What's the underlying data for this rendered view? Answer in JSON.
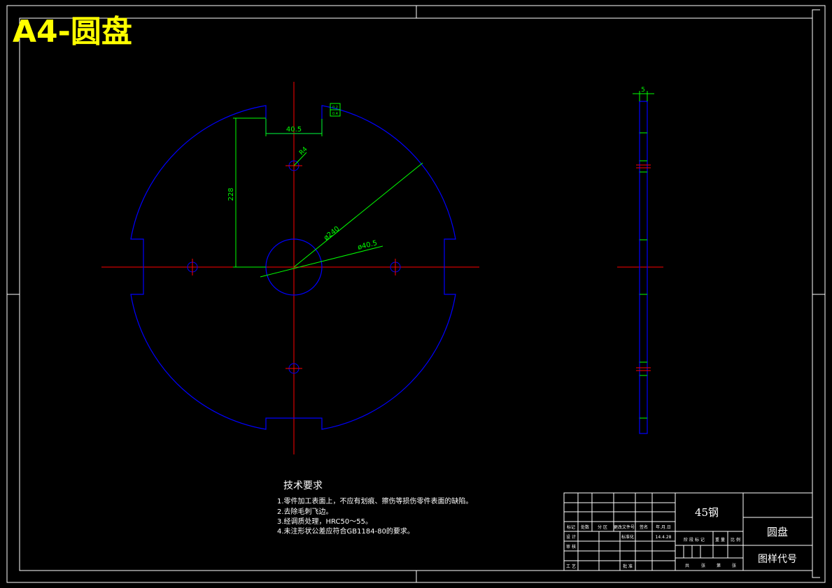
{
  "sheet": {
    "title": "A4-圆盘"
  },
  "dimensions": {
    "slot_width": "40.5",
    "height_from_center": "228",
    "small_hole_dia": "R4",
    "outer_dia": "ø240",
    "bore_dia": "ø40.5",
    "side_thickness": "5",
    "slot_tol_upper": "0.2",
    "slot_tol_lower": "0.4"
  },
  "tech_requirements": {
    "heading": "技术要求",
    "items": [
      "1.零件加工表面上，不应有划痕、擦伤等损伤零件表面的缺陷。",
      "2.去除毛刺飞边。",
      "3.经调质处理，HRC50～55。",
      "4.未注形状公差应符合GB1184-80的要求。"
    ]
  },
  "title_block": {
    "material": "45钢",
    "part_name": "圆盘",
    "drawing_code": "图样代号",
    "row_labels": [
      "标记",
      "处数",
      "分 区",
      "更改文件号",
      "签名",
      "年.月.日"
    ],
    "design": "设 计",
    "standardize": "标准化",
    "date": "14.4.28",
    "check": "审 核",
    "process": "工 艺",
    "approve": "批 准",
    "stage_labels": [
      "阶 段 标 记",
      "重 量",
      "比 例"
    ],
    "sheet_labels": [
      "共",
      "张",
      "第",
      "张"
    ]
  },
  "colors": {
    "background": "#000000",
    "frame": "#ffffff",
    "outline": "#0000ff",
    "centerline": "#ff0000",
    "dimension": "#00ff00",
    "title": "#ffff00"
  }
}
